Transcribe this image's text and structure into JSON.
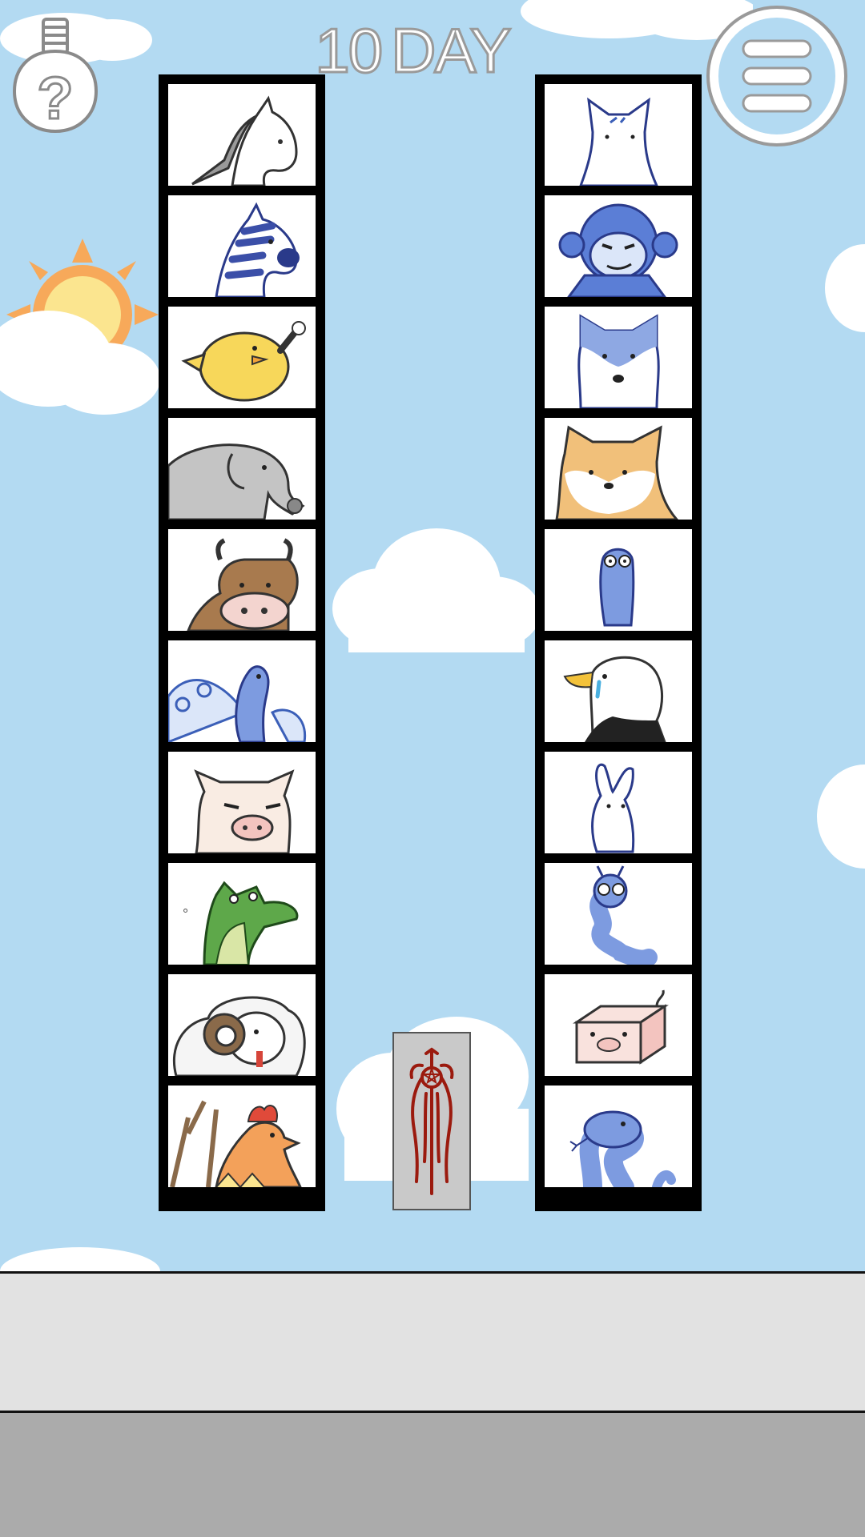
{
  "header": {
    "day_number": "10",
    "day_label": "DAY"
  },
  "buttons": {
    "hint_icon": "lightbulb-question-icon",
    "menu_icon": "hamburger-menu-icon"
  },
  "left_column": [
    {
      "animal": "horse"
    },
    {
      "animal": "zebra"
    },
    {
      "animal": "chick"
    },
    {
      "animal": "elephant"
    },
    {
      "animal": "cow"
    },
    {
      "animal": "peacock"
    },
    {
      "animal": "pig"
    },
    {
      "animal": "crocodile"
    },
    {
      "animal": "sheep"
    },
    {
      "animal": "rooster"
    }
  ],
  "right_column": [
    {
      "animal": "cat"
    },
    {
      "animal": "monkey"
    },
    {
      "animal": "husky"
    },
    {
      "animal": "shiba"
    },
    {
      "animal": "blue-creature"
    },
    {
      "animal": "eagle"
    },
    {
      "animal": "rabbit"
    },
    {
      "animal": "caterpillar"
    },
    {
      "animal": "box-pig"
    },
    {
      "animal": "snake"
    }
  ],
  "center_card": {
    "symbol": "red-sigil-icon"
  },
  "colors": {
    "sky": "#b3daf2",
    "panel_light": "#e2e2e2",
    "panel_dark": "#ababab",
    "sigil": "#9b1a0e"
  }
}
